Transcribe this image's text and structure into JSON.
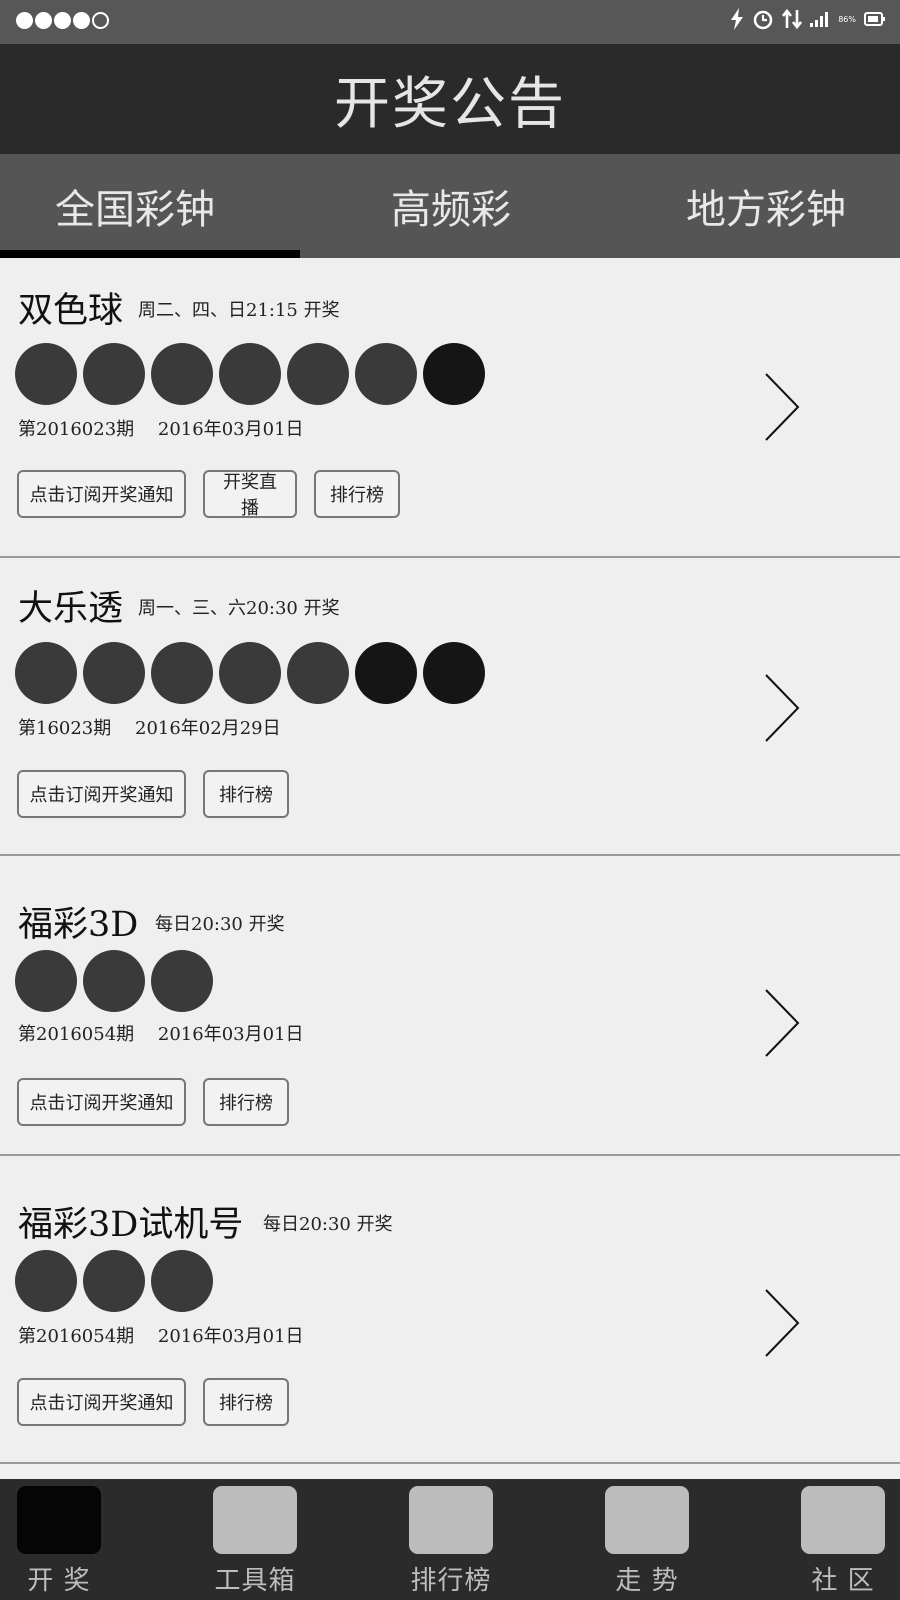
{
  "header": {
    "title": "开奖公告"
  },
  "status": {
    "battery": "86%"
  },
  "tabs": [
    {
      "label": "全国彩钟",
      "active": true
    },
    {
      "label": "高频彩",
      "active": false
    },
    {
      "label": "地方彩钟",
      "active": false
    }
  ],
  "lotteries": [
    {
      "name": "双色球",
      "schedule": "周二、四、日21:15 开奖",
      "ball_count": 7,
      "issue": "第2016023期",
      "date": "2016年03月01日",
      "buttons": [
        "点击订阅开奖通知",
        "开奖直播",
        "排行榜"
      ]
    },
    {
      "name": "大乐透",
      "schedule": "周一、三、六20:30 开奖",
      "ball_count": 7,
      "issue": "第16023期",
      "date": "2016年02月29日",
      "buttons": [
        "点击订阅开奖通知",
        "排行榜"
      ]
    },
    {
      "name": "福彩3D",
      "schedule": "每日20:30 开奖",
      "ball_count": 3,
      "issue": "第2016054期",
      "date": "2016年03月01日",
      "buttons": [
        "点击订阅开奖通知",
        "排行榜"
      ]
    },
    {
      "name": "福彩3D试机号",
      "schedule": "每日20:30 开奖",
      "ball_count": 3,
      "issue": "第2016054期",
      "date": "2016年03月01日",
      "buttons": [
        "点击订阅开奖通知",
        "排行榜"
      ]
    }
  ],
  "nav": [
    {
      "label": "开 奖",
      "active": true
    },
    {
      "label": "工具箱",
      "active": false
    },
    {
      "label": "排行榜",
      "active": false
    },
    {
      "label": "走 势",
      "active": false
    },
    {
      "label": "社 区",
      "active": false
    }
  ]
}
